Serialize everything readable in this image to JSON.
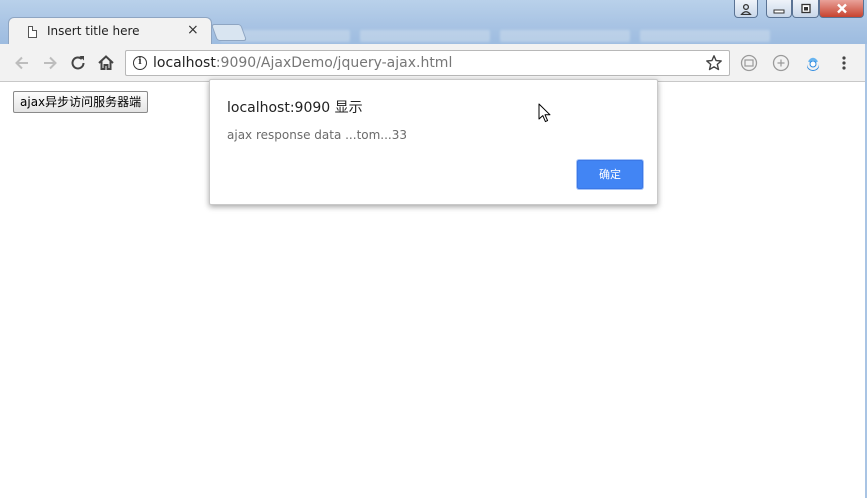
{
  "browser": {
    "tab_title": "Insert title here",
    "tab_close_glyph": "×",
    "url_host": "localhost",
    "url_path": ":9090/AjaxDemo/jquery-ajax.html",
    "info_glyph": "i"
  },
  "page": {
    "button_label": "ajax异步访问服务器端"
  },
  "dialog": {
    "title": "localhost:9090 显示",
    "message": "ajax response data ...tom...33",
    "ok_label": "确定"
  },
  "colors": {
    "accent": "#4285f4",
    "titlebar": "#a9c4e4",
    "toolbar": "#f2f2f2"
  },
  "icons": [
    "back-icon",
    "forward-icon",
    "reload-icon",
    "home-icon",
    "info-icon",
    "star-icon",
    "extension-icon",
    "menu-icon",
    "cursor-icon"
  ]
}
